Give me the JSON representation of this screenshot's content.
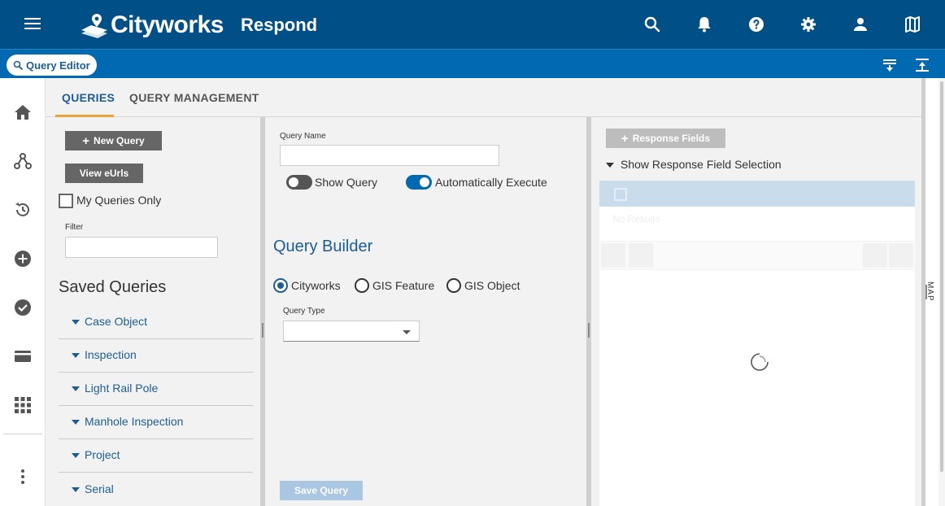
{
  "header": {
    "logo_text": "Cityworks",
    "app_title": "Respond",
    "icons": [
      "menu-icon",
      "search-icon",
      "bell-icon",
      "help-icon",
      "gear-icon",
      "user-icon",
      "map-icon"
    ],
    "bg_color": "#004f87"
  },
  "subbar": {
    "query_editor_label": "Query Editor",
    "icons": [
      "collapse-down-icon",
      "collapse-up-icon"
    ],
    "bg_color": "#0069b1"
  },
  "leftnav": {
    "icons": [
      "home-icon",
      "hierarchy-icon",
      "history-icon",
      "add-circle-icon",
      "check-circle-icon",
      "card-icon",
      "apps-grid-icon",
      "more-vertical-icon"
    ]
  },
  "tabs": [
    {
      "label": "QUERIES",
      "active": true
    },
    {
      "label": "QUERY MANAGEMENT",
      "active": false
    }
  ],
  "queries_panel": {
    "new_query_label": "New Query",
    "view_eurls_label": "View eUrls",
    "my_queries_only_label": "My Queries Only",
    "filter_label": "Filter",
    "filter_value": "",
    "saved_queries_title": "Saved Queries",
    "saved_queries": [
      "Case Object",
      "Inspection",
      "Light Rail Pole",
      "Manhole Inspection",
      "Project",
      "Serial"
    ]
  },
  "query_form": {
    "query_name_label": "Query Name",
    "query_name_value": "",
    "show_query_label": "Show Query",
    "show_query_on": false,
    "auto_execute_label": "Automatically Execute",
    "auto_execute_on": true,
    "query_builder_title": "Query Builder",
    "radio_options": [
      "Cityworks",
      "GIS Feature",
      "GIS Object"
    ],
    "radio_selected": "Cityworks",
    "query_type_label": "Query Type",
    "query_type_value": "",
    "save_query_label": "Save Query"
  },
  "response_panel": {
    "response_fields_label": "Response Fields",
    "show_selection_label": "Show Response Field Selection",
    "no_results_text": "No Results"
  },
  "map_strip": {
    "label": "MAP"
  },
  "colors": {
    "accent": "#1d5d95",
    "tab_underline": "#e8a33b",
    "toggle_on": "#0069b1"
  }
}
